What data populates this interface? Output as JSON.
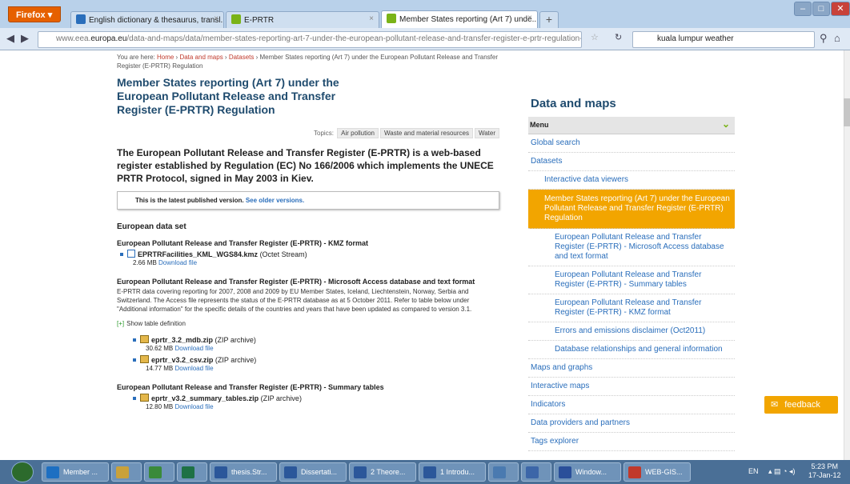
{
  "browser": {
    "menu_label": "Firefox ▾",
    "tabs": [
      {
        "label": "English dictionary & thesaurus, transl...",
        "active": false
      },
      {
        "label": "E-PRTR",
        "active": false
      },
      {
        "label": "Member States reporting (Art 7) unde...",
        "active": true
      }
    ],
    "new_tab": "+",
    "url": "www.eea.europa.eu/data-and-maps/data/member-states-reporting-art-7-under-the-european-pollutant-release-and-transfer-register-e-prtr-regulation-4",
    "url_host": "www.eea.",
    "url_host_bold": "europa.eu",
    "url_rest": "/data-and-maps/data/member-states-reporting-art-7-under-the-european-pollutant-release-and-transfer-register-e-prtr-regulation-4",
    "search_value": "kuala lumpur weather"
  },
  "breadcrumb": {
    "prefix": "You are here:",
    "items": [
      "Home",
      "Data and maps",
      "Datasets"
    ],
    "current": "Member States reporting (Art 7) under the European Pollutant Release and Transfer Register (E-PRTR) Regulation"
  },
  "page": {
    "title": "Member States reporting (Art 7) under the European Pollutant Release and Transfer Register (E-PRTR) Regulation",
    "topics_label": "Topics:",
    "topics": [
      "Air pollution",
      "Waste and material resources",
      "Water"
    ],
    "intro": "The European Pollutant Release and Transfer Register (E-PRTR) is a web-based register established by Regulation (EC) No 166/2006 which implements the UNECE PRTR Protocol, signed in May 2003 in Kiev.",
    "notice_text": "This is the latest published version.",
    "notice_link": "See older versions.",
    "dataset_heading": "European data set",
    "sections": [
      {
        "heading": "European Pollutant Release and Transfer Register (E-PRTR) - KMZ format",
        "files": [
          {
            "name": "EPRTRFacilities_KML_WGS84.kmz",
            "type": "(Octet Stream)",
            "size": "2.66 MB",
            "link": "Download file"
          }
        ]
      },
      {
        "heading": "European Pollutant Release and Transfer Register (E-PRTR) - Microsoft Access database and text format",
        "desc": "E-PRTR data covering reporting for 2007, 2008 and 2009 by EU Member States, Iceland, Liechtenstein, Norway, Serbia and Switzerland. The Access file represents the status of the E-PRTR database as at 5 October 2011. Refer to table below under \"Additional information\" for the specific details of the countries and years that have been updated as compared to version 3.1.",
        "toggle_mark": "[+]",
        "toggle_label": "Show table definition",
        "files": [
          {
            "name": "eprtr_3.2_mdb.zip",
            "type": "(ZIP archive)",
            "size": "30.62 MB",
            "link": "Download file"
          },
          {
            "name": "eprtr_v3.2_csv.zip",
            "type": "(ZIP archive)",
            "size": "14.77 MB",
            "link": "Download file"
          }
        ]
      },
      {
        "heading": "European Pollutant Release and Transfer Register (E-PRTR) - Summary tables",
        "files": [
          {
            "name": "eprtr_v3.2_summary_tables.zip",
            "type": "(ZIP archive)",
            "size": "12.80 MB",
            "link": "Download file"
          }
        ]
      }
    ]
  },
  "sidebar": {
    "title": "Data and maps",
    "menu_label": "Menu",
    "items": [
      {
        "label": "Global search",
        "level": 1
      },
      {
        "label": "Datasets",
        "level": 1
      },
      {
        "label": "Interactive data viewers",
        "level": 2
      },
      {
        "label": "Member States reporting (Art 7) under the European Pollutant Release and Transfer Register (E-PRTR) Regulation",
        "level": 2,
        "active": true
      },
      {
        "label": "European Pollutant Release and Transfer Register (E-PRTR) - Microsoft Access database and text format",
        "level": 3
      },
      {
        "label": "European Pollutant Release and Transfer Register (E-PRTR) - Summary tables",
        "level": 3
      },
      {
        "label": "European Pollutant Release and Transfer Register (E-PRTR) - KMZ format",
        "level": 3
      },
      {
        "label": "Errors and emissions disclaimer (Oct2011)",
        "level": 3
      },
      {
        "label": "Database relationships and general information",
        "level": 3
      },
      {
        "label": "Maps and graphs",
        "level": 1
      },
      {
        "label": "Interactive maps",
        "level": 1
      },
      {
        "label": "Indicators",
        "level": 1
      },
      {
        "label": "Data providers and partners",
        "level": 1
      },
      {
        "label": "Tags explorer",
        "level": 1
      }
    ],
    "feedback": "feedback"
  },
  "taskbar": {
    "items": [
      {
        "label": "Member ...",
        "color": "#1d6fc2"
      },
      {
        "label": "",
        "color": "#c9a13a"
      },
      {
        "label": "",
        "color": "#3a8a3a"
      },
      {
        "label": "",
        "color": "#1e7145"
      },
      {
        "label": "thesis.Str...",
        "color": "#2b579a"
      },
      {
        "label": "Dissertati...",
        "color": "#2b579a"
      },
      {
        "label": "2 Theore...",
        "color": "#2b579a"
      },
      {
        "label": "1 Introdu...",
        "color": "#2b579a"
      },
      {
        "label": "",
        "color": "#4a7ab0"
      },
      {
        "label": "",
        "color": "#3c66a8"
      },
      {
        "label": "Window...",
        "color": "#2a4f9a"
      },
      {
        "label": "WEB-GIS...",
        "color": "#c0392b"
      }
    ],
    "lang": "EN",
    "time": "5:23 PM",
    "date": "17-Jan-12"
  },
  "colors": {
    "accent": "#f2a500",
    "title": "#1f4b6e",
    "link": "#2a6ebb"
  }
}
